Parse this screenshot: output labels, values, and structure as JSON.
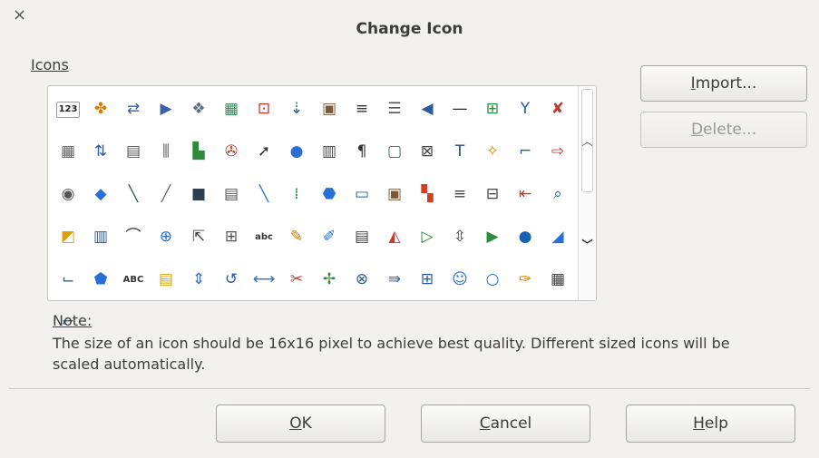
{
  "window": {
    "title": "Change Icon",
    "close_glyph": "×"
  },
  "icons_section": {
    "label": "Icons"
  },
  "icons": [
    {
      "name": "number-field-icon",
      "glyph": "123",
      "color": "#222222"
    },
    {
      "name": "extension-puzzle-icon",
      "glyph": "✤",
      "color": "#e07a00"
    },
    {
      "name": "arrows-bracket-icon",
      "glyph": "⇄",
      "color": "#3b5fa8"
    },
    {
      "name": "page-forward-icon",
      "glyph": "▶",
      "color": "#3b5fa8"
    },
    {
      "name": "database-icon",
      "glyph": "❖",
      "color": "#5b6f8a"
    },
    {
      "name": "table-grid-icon",
      "glyph": "▦",
      "color": "#3b8a5b"
    },
    {
      "name": "form-field-icon",
      "glyph": "⊡",
      "color": "#c0392b"
    },
    {
      "name": "sort-ascending-icon",
      "glyph": "⇣",
      "color": "#2c5aa0"
    },
    {
      "name": "form-design-icon",
      "glyph": "▣",
      "color": "#7a5a3a"
    },
    {
      "name": "align-justify-icon",
      "glyph": "≡",
      "color": "#333333"
    },
    {
      "name": "align-lines-icon",
      "glyph": "☰",
      "color": "#555555"
    },
    {
      "name": "undo-arrow-icon",
      "glyph": "◀",
      "color": "#2c5aa0"
    },
    {
      "name": "horizontal-line-icon",
      "glyph": "—",
      "color": "#222222"
    },
    {
      "name": "grid-snap-icon",
      "glyph": "⊞",
      "color": "#2c8a3b"
    },
    {
      "name": "branch-icon",
      "glyph": "Y",
      "color": "#2c5aa0"
    },
    {
      "name": "delete-arrow-icon",
      "glyph": "✘",
      "color": "#c0392b"
    },
    {
      "name": "spreadsheet-icon",
      "glyph": "▦",
      "color": "#666666"
    },
    {
      "name": "insert-rows-icon",
      "glyph": "⇅",
      "color": "#2c5aa0"
    },
    {
      "name": "record-grid-icon",
      "glyph": "▤",
      "color": "#555555"
    },
    {
      "name": "columns-icon",
      "glyph": "⫼",
      "color": "#555555"
    },
    {
      "name": "chart-data-icon",
      "glyph": "▙",
      "color": "#2c8a3b"
    },
    {
      "name": "image-settings-icon",
      "glyph": "✇",
      "color": "#c0392b"
    },
    {
      "name": "pointer-icon",
      "glyph": "➚",
      "color": "#333333"
    },
    {
      "name": "circle-icon",
      "glyph": "●",
      "color": "#2a6fd6"
    },
    {
      "name": "document-grid-icon",
      "glyph": "▥",
      "color": "#444444"
    },
    {
      "name": "paragraph-icon",
      "glyph": "¶",
      "color": "#333333"
    },
    {
      "name": "rounded-square-icon",
      "glyph": "▢",
      "color": "#2c5aa0"
    },
    {
      "name": "text-frame-icon",
      "glyph": "⊠",
      "color": "#444444"
    },
    {
      "name": "fontwork-text-icon",
      "glyph": "T",
      "color": "#2c4a7a"
    },
    {
      "name": "magic-wand-icon",
      "glyph": "✧",
      "color": "#c89a00"
    },
    {
      "name": "connector-icon",
      "glyph": "⌐",
      "color": "#2c5aa0"
    },
    {
      "name": "export-arrow-icon",
      "glyph": "⇨",
      "color": "#c0392b"
    },
    {
      "name": "toggle-button-icon",
      "glyph": "◉",
      "color": "#555555"
    },
    {
      "name": "diamond-icon",
      "glyph": "◆",
      "color": "#2a6fd6"
    },
    {
      "name": "slanted-line-icon",
      "glyph": "╲",
      "color": "#3b4a6a"
    },
    {
      "name": "pencil-line-icon",
      "glyph": "╱",
      "color": "#666666"
    },
    {
      "name": "save-icon",
      "glyph": "■",
      "color": "#2c3e50"
    },
    {
      "name": "page-layout-icon",
      "glyph": "▤",
      "color": "#555555"
    },
    {
      "name": "line-tool-icon",
      "glyph": "╲",
      "color": "#2a6fd6"
    },
    {
      "name": "bar-chart-icon",
      "glyph": "⁞",
      "color": "#2c8a3b"
    },
    {
      "name": "octagon-icon",
      "glyph": "⬣",
      "color": "#2a6fd6"
    },
    {
      "name": "presentation-icon",
      "glyph": "▭",
      "color": "#2c5aa0"
    },
    {
      "name": "form-controls-icon",
      "glyph": "▣",
      "color": "#7a5a3a"
    },
    {
      "name": "color-palette-icon",
      "glyph": "▚",
      "color": "#d04020"
    },
    {
      "name": "align-center-icon",
      "glyph": "≡",
      "color": "#444444"
    },
    {
      "name": "line-number-icon",
      "glyph": "⊟",
      "color": "#444444"
    },
    {
      "name": "indent-icon",
      "glyph": "⇤",
      "color": "#c0392b"
    },
    {
      "name": "zoom-page-icon",
      "glyph": "⌕",
      "color": "#2c5aa0"
    },
    {
      "name": "shadow-box-icon",
      "glyph": "◩",
      "color": "#e0a000"
    },
    {
      "name": "form-navigation-icon",
      "glyph": "▥",
      "color": "#2c5aa0"
    },
    {
      "name": "arc-icon",
      "glyph": "⌒",
      "color": "#333333"
    },
    {
      "name": "crosshair-circle-icon",
      "glyph": "⊕",
      "color": "#2a6fd6"
    },
    {
      "name": "select-pointer-icon",
      "glyph": "⇱",
      "color": "#444444"
    },
    {
      "name": "check-grid-icon",
      "glyph": "⊞",
      "color": "#555555"
    },
    {
      "name": "spellcheck-icon",
      "glyph": "abc",
      "color": "#333333"
    },
    {
      "name": "highlighter-icon",
      "glyph": "✎",
      "color": "#e07a00"
    },
    {
      "name": "draw-line-icon",
      "glyph": "✐",
      "color": "#2a6fd6"
    },
    {
      "name": "table-design-icon",
      "glyph": "▤",
      "color": "#444444"
    },
    {
      "name": "fill-color-icon",
      "glyph": "◭",
      "color": "#c0392b"
    },
    {
      "name": "play-spark-icon",
      "glyph": "▷",
      "color": "#2c8a3b"
    },
    {
      "name": "number-spinner-icon",
      "glyph": "⇳",
      "color": "#444444"
    },
    {
      "name": "media-play-icon",
      "glyph": "▶",
      "color": "#2c8a3b"
    },
    {
      "name": "sphere-icon",
      "glyph": "●",
      "color": "#1a5fb4"
    },
    {
      "name": "folder-icon",
      "glyph": "◢",
      "color": "#2a6fd6"
    },
    {
      "name": "flowchart-connector-icon",
      "glyph": "⌙",
      "color": "#2c5aa0"
    },
    {
      "name": "pentagon-icon",
      "glyph": "⬟",
      "color": "#2a6fd6"
    },
    {
      "name": "text-label-icon",
      "glyph": "ABC",
      "color": "#333333"
    },
    {
      "name": "document-notes-icon",
      "glyph": "▤",
      "color": "#e0a000"
    },
    {
      "name": "vertical-arrows-icon",
      "glyph": "⇕",
      "color": "#2a6fd6"
    },
    {
      "name": "rotate-back-icon",
      "glyph": "↺",
      "color": "#2c5aa0"
    },
    {
      "name": "horizontal-arrows-icon",
      "glyph": "⟷",
      "color": "#2a6fd6"
    },
    {
      "name": "crop-image-icon",
      "glyph": "✂",
      "color": "#c0392b"
    },
    {
      "name": "edit-points-icon",
      "glyph": "✢",
      "color": "#2c8a3b"
    },
    {
      "name": "zoom-shape-icon",
      "glyph": "⊗",
      "color": "#2c5aa0"
    },
    {
      "name": "forward-arrow-icon",
      "glyph": "⇛",
      "color": "#2a6fd6"
    },
    {
      "name": "text-box-arrows-icon",
      "glyph": "⊞",
      "color": "#2c5aa0"
    },
    {
      "name": "smiley-icon",
      "glyph": "☺",
      "color": "#2a6fd6"
    },
    {
      "name": "circle-outline-icon",
      "glyph": "○",
      "color": "#2a6fd6"
    },
    {
      "name": "pen-icon",
      "glyph": "✑",
      "color": "#e07a00"
    },
    {
      "name": "table-pointer-icon",
      "glyph": "▦",
      "color": "#444444"
    },
    {
      "name": "elbow-connector-icon",
      "glyph": "⌐",
      "color": "#2c5aa0"
    }
  ],
  "buttons": {
    "import": {
      "accel": "I",
      "rest": "mport..."
    },
    "delete": {
      "accel": "D",
      "rest": "elete..."
    },
    "ok": {
      "accel": "O",
      "rest": "K"
    },
    "cancel": {
      "accel": "C",
      "rest": "ancel"
    },
    "help": {
      "accel": "H",
      "rest": "elp"
    }
  },
  "note": {
    "title": "Note:",
    "text": "The size of an icon should be 16x16 pixel to achieve best quality. Different sized icons will be scaled automatically."
  }
}
